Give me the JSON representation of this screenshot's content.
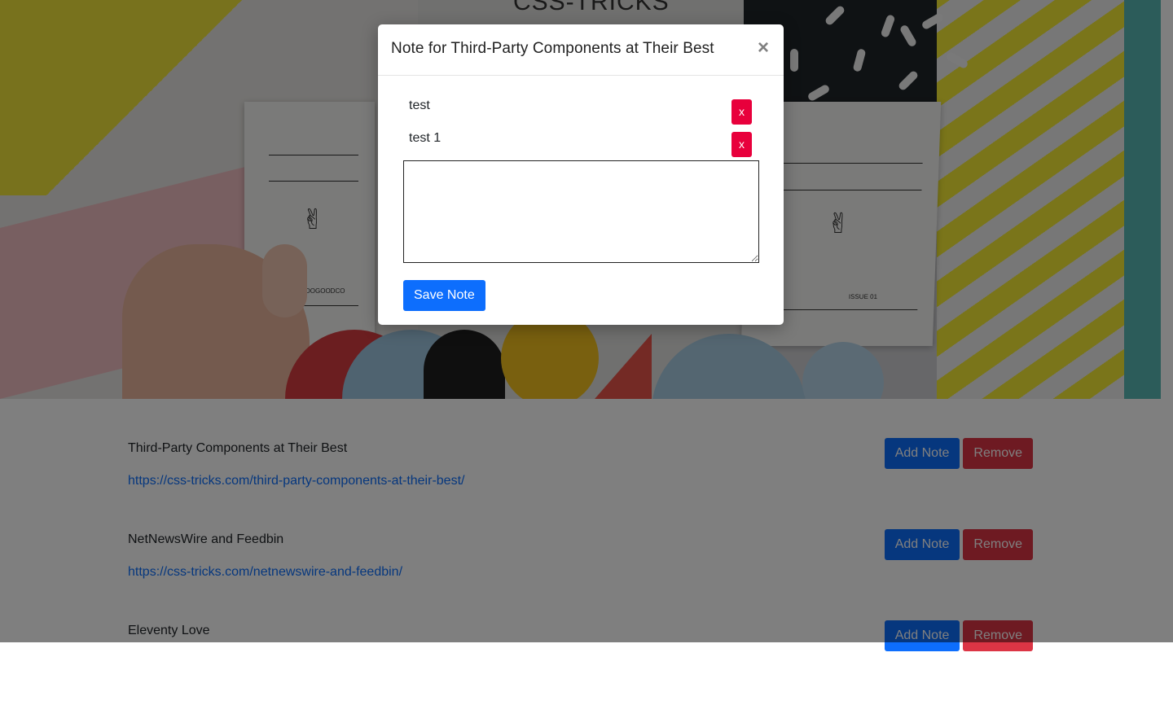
{
  "hero": {
    "site_name": "CSS-TRICKS",
    "card_left_label": "DOGOODCO",
    "card_right_label": "ISSUE 01"
  },
  "articles": [
    {
      "title": "Third-Party Components at Their Best",
      "url": "https://css-tricks.com/third-party-components-at-their-best/",
      "add_note_label": "Add Note",
      "remove_label": "Remove"
    },
    {
      "title": "NetNewsWire and Feedbin",
      "url": "https://css-tricks.com/netnewswire-and-feedbin/",
      "add_note_label": "Add Note",
      "remove_label": "Remove"
    },
    {
      "title": "Eleventy Love",
      "url": "",
      "add_note_label": "Add Note",
      "remove_label": "Remove"
    }
  ],
  "modal": {
    "title": "Note for Third-Party Components at Their Best",
    "close_glyph": "×",
    "notes": [
      {
        "text": "test",
        "delete_label": "x"
      },
      {
        "text": "test 1",
        "delete_label": "x"
      }
    ],
    "new_note_value": "",
    "save_label": "Save Note"
  },
  "colors": {
    "primary": "#0d6efd",
    "danger": "#dc3545",
    "note_delete": "#e8003c",
    "backdrop": "rgba(0,0,0,0.5)"
  }
}
